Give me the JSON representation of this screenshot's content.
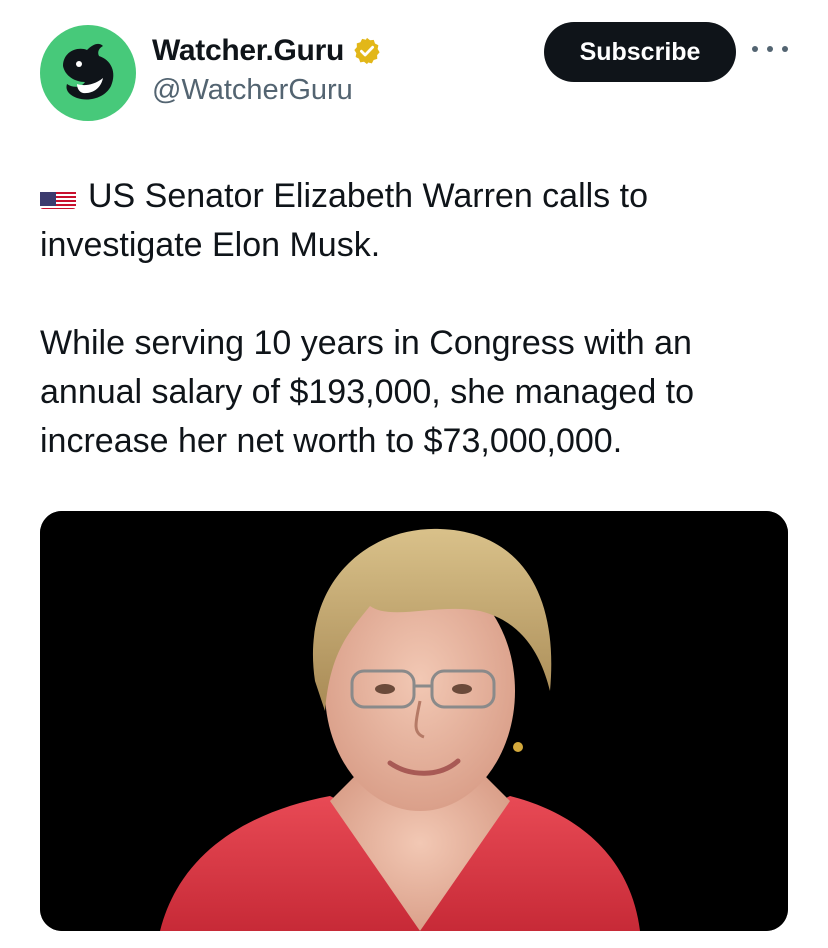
{
  "author": {
    "name": "Watcher.Guru",
    "handle": "@WatcherGuru",
    "verified": true,
    "avatar_icon": "whale-icon",
    "avatar_color": "#47c97a",
    "verified_color": "#e2b719"
  },
  "actions": {
    "subscribe_label": "Subscribe",
    "more_icon": "more-horizontal-icon"
  },
  "tweet": {
    "flag_emoji": "us-flag-icon",
    "line1": "US Senator Elizabeth Warren calls to investigate Elon Musk.",
    "line2": "While serving 10 years in Congress with an annual salary of $193,000, she managed to increase her net worth to $73,000,000."
  },
  "media": {
    "type": "photo",
    "background": "#000000"
  }
}
